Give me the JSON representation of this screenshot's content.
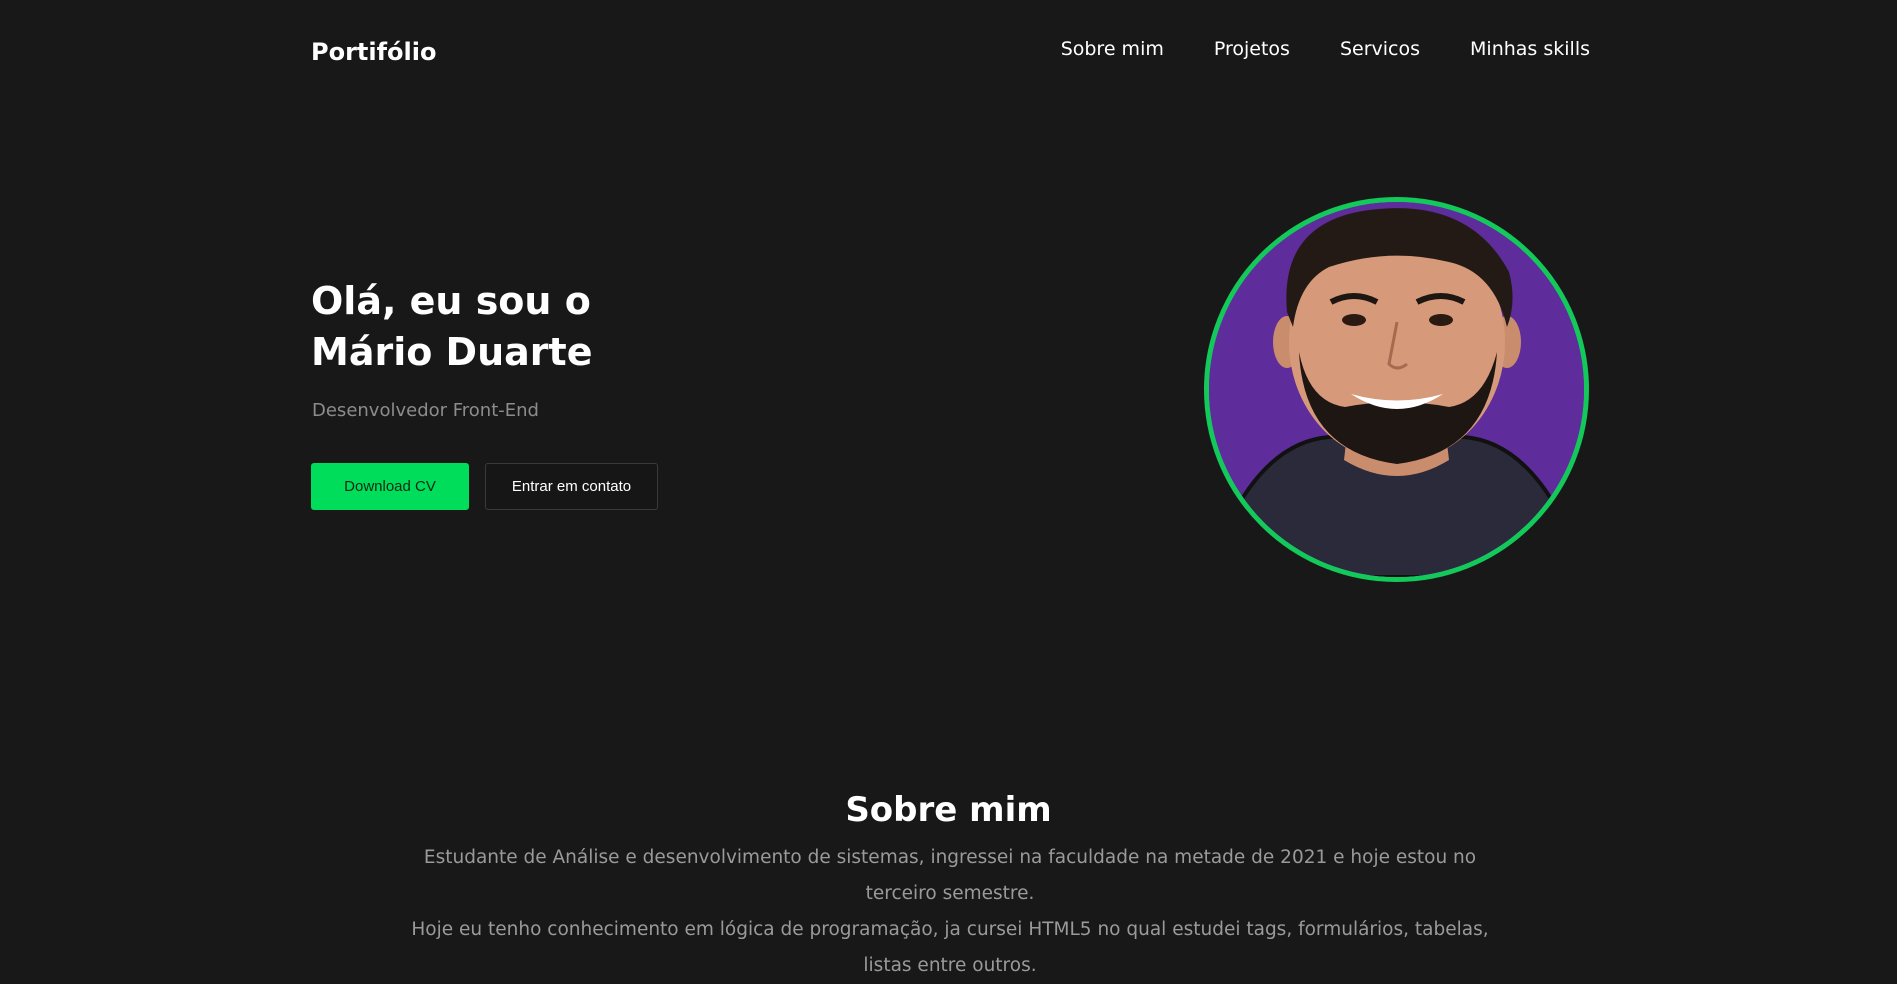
{
  "nav": {
    "logo": "Portifólio",
    "links": [
      "Sobre mim",
      "Projetos",
      "Servicos",
      "Minhas skills"
    ]
  },
  "hero": {
    "title_line1": "Olá, eu sou o",
    "title_line2": "Mário Duarte",
    "subtitle": "Desenvolvedor Front-End",
    "download_label": "Download CV",
    "contact_label": "Entrar em contato"
  },
  "about": {
    "title": "Sobre mim",
    "paragraph1": "Estudante de Análise e desenvolvimento de sistemas, ingressei na faculdade na metade de 2021 e hoje estou no terceiro semestre.",
    "paragraph2": "Hoje eu tenho conhecimento em lógica de programação, ja cursei HTML5 no qual estudei tags, formulários, tabelas, listas entre outros."
  },
  "colors": {
    "background": "#181818",
    "accent": "#00dd5b",
    "avatar_bg": "#5f2c9c",
    "muted_text": "#8c8c8c"
  }
}
